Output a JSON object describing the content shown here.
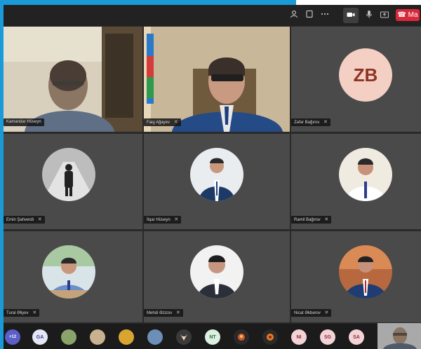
{
  "toolbar": {
    "leave_label": "Ma",
    "icons": [
      "people-icon",
      "chat-icon",
      "more-icon",
      "camera-icon",
      "mic-icon",
      "share-icon"
    ]
  },
  "tiles": [
    {
      "name": "Kamandar Hüseyn",
      "type": "video"
    },
    {
      "name": "Faig Ağayev",
      "type": "video"
    },
    {
      "name": "Zəfər Bağırov",
      "type": "initials",
      "initials": "ZB"
    },
    {
      "name": "Emin Şahverdi",
      "type": "photo"
    },
    {
      "name": "İlqar Hüseyn",
      "type": "photo"
    },
    {
      "name": "Ramil Bağırov",
      "type": "photo"
    },
    {
      "name": "Tural Əliyev",
      "type": "photo"
    },
    {
      "name": "Mehdi Əzizov",
      "type": "photo"
    },
    {
      "name": "Nicat Əkbərov",
      "type": "photo"
    }
  ],
  "bottom_bar": {
    "participant_count": "+12",
    "items": [
      {
        "initials": "GA"
      },
      {
        "initials": ""
      },
      {
        "initials": ""
      },
      {
        "initials": ""
      },
      {
        "initials": ""
      },
      {
        "initials": ""
      },
      {
        "initials": "NT"
      },
      {
        "initials": ""
      },
      {
        "initials": ""
      },
      {
        "initials": "NI"
      },
      {
        "initials": "SG"
      },
      {
        "initials": "SA"
      }
    ]
  },
  "colors": {
    "accent": "#1a9bd7",
    "leave": "#d9283a",
    "initials_bg": "#f3cfc4",
    "initials_text": "#8d3524"
  }
}
